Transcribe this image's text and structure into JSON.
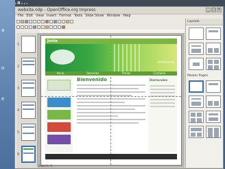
{
  "background": {
    "top_text": "...a...",
    "left_labels": [
      "a",
      "o",
      "e"
    ]
  },
  "window": {
    "title": "website.odp - OpenOffice.org Impress",
    "menus": [
      "File",
      "Edit",
      "View",
      "Insert",
      "Format",
      "Tools",
      "Slide Show",
      "Window",
      "Help"
    ]
  },
  "slides_pane": {
    "numbers": [
      "1",
      "2",
      "3",
      "4",
      "5",
      "6"
    ],
    "selected_index": 5
  },
  "slide": {
    "site_header": "Junta",
    "banner_tag": "Andalucía",
    "nav": [
      "Inicio",
      "Servicios",
      "Temas",
      "Contacto"
    ],
    "main_heading": "Bienvenido",
    "right_heading": "Destacados"
  },
  "task_pane": {
    "title": "Layouts",
    "section2": "Master Pages"
  },
  "status": {
    "text": "Slide 6 / 6"
  },
  "colors": {
    "accent_green": "#3aa843",
    "selection_blue": "#3d6fb6"
  }
}
